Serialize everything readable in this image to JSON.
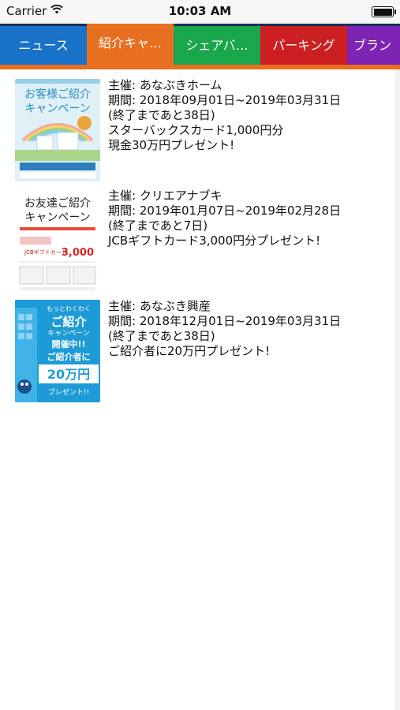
{
  "status_bar": {
    "carrier": "Carrier",
    "time": "10:03 AM",
    "battery_level": 1.0
  },
  "tabs": [
    {
      "label": "ニュース",
      "color": "#1973c8",
      "active": false
    },
    {
      "label": "紹介キャ…",
      "color": "#e86f1f",
      "active": true
    },
    {
      "label": "シェアバ…",
      "color": "#1aa64a",
      "active": false
    },
    {
      "label": "パーキング",
      "color": "#cc1f22",
      "active": false
    },
    {
      "label": "ブラン",
      "color": "#7d24b5",
      "active": false
    }
  ],
  "campaigns": [
    {
      "host": "主催: あなぶきホーム",
      "period": "期間: 2018年09月01日~2019年03月31日",
      "remaining": "(終了まであと38日)",
      "benefit_lines": [
        "スターバックスカード1,000円分",
        "現金30万円プレゼント!"
      ],
      "thumbnail": {
        "icon": "customer-referral-flyer-thumbnail",
        "title_lines": [
          "お客様ご紹介",
          "キャンペーン"
        ]
      }
    },
    {
      "host": "主催: クリエアナブキ",
      "period": "期間: 2019年01月07日~2019年02月28日",
      "remaining": "(終了まであと7日)",
      "benefit_lines": [
        "JCBギフトカード3,000円分プレゼント!"
      ],
      "thumbnail": {
        "icon": "friend-referral-flyer-thumbnail",
        "title_lines": [
          "お友達ご紹介",
          "キャンペーン"
        ],
        "amount": "3,000",
        "badge": "JCBギフトカード"
      }
    },
    {
      "host": "主催: あなぶき興産",
      "period": "期間: 2018年12月01日~2019年03月31日",
      "remaining": "(終了まであと38日)",
      "benefit_lines": [
        "ご紹介者に20万円プレゼント!"
      ],
      "thumbnail": {
        "icon": "referral-20man-flyer-thumbnail",
        "title_lines": [
          "もっとわくわく",
          "ご紹介",
          "キャンペーン",
          "開催中!!",
          "ご紹介者に",
          "20万円",
          "プレゼント!!"
        ]
      }
    }
  ]
}
